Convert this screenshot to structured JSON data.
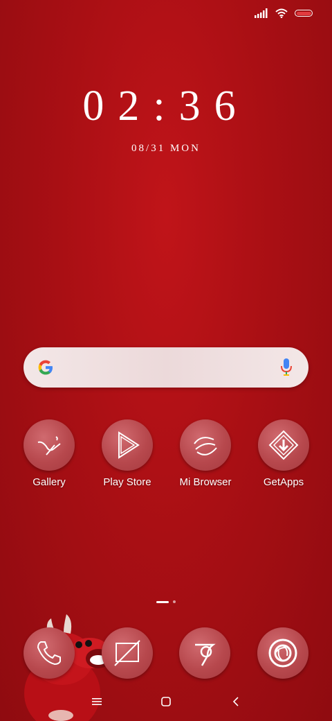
{
  "status_bar": {
    "icons": [
      "signal-icon",
      "wifi-icon",
      "battery-icon"
    ],
    "battery_color": "#e23b3f"
  },
  "lock_clock": {
    "time": "02:36",
    "date": "08/31 MON"
  },
  "search_bar": {
    "logo": "google-g-icon",
    "mic": "microphone-icon"
  },
  "apps": [
    {
      "label": "Gallery",
      "icon": "gallery-icon"
    },
    {
      "label": "Play Store",
      "icon": "play-store-icon"
    },
    {
      "label": "Mi Browser",
      "icon": "browser-icon"
    },
    {
      "label": "GetApps",
      "icon": "getapps-icon"
    }
  ],
  "page_indicator": {
    "pages": 2,
    "current": 1
  },
  "dock": [
    {
      "icon": "phone-icon"
    },
    {
      "icon": "messaging-icon"
    },
    {
      "icon": "chrome-icon"
    },
    {
      "icon": "camera-icon"
    }
  ],
  "nav_bar": {
    "items": [
      "menu-icon",
      "home-icon",
      "back-icon"
    ]
  },
  "colors": {
    "wallpaper": "#a90f14",
    "icon_circle": "#b7484d",
    "text": "#ffffff"
  }
}
